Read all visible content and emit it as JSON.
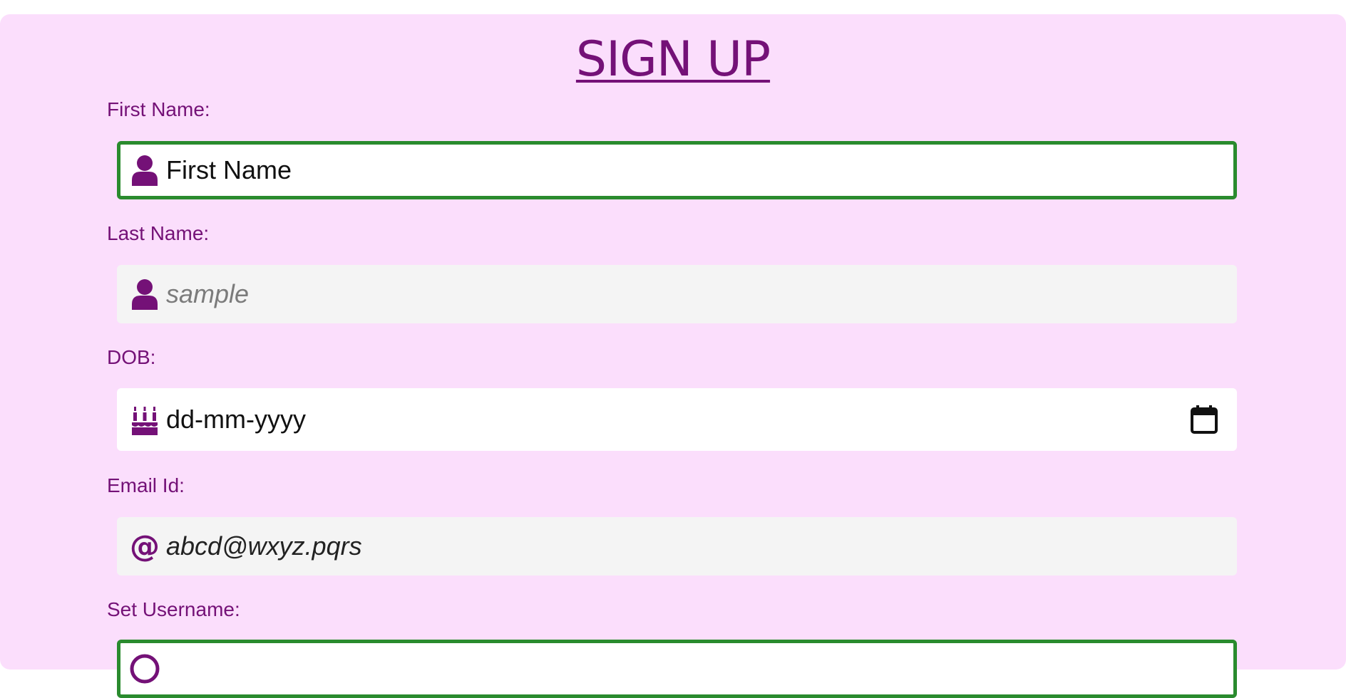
{
  "form": {
    "title": "SIGN UP",
    "accent_color": "#741177",
    "focus_border_color": "#2a8b2e",
    "background_color": "#fbdefc",
    "fields": [
      {
        "label": "First Name:",
        "icon": "user-icon",
        "value": "First Name",
        "placeholder": "",
        "state": "focused"
      },
      {
        "label": "Last Name:",
        "icon": "user-icon",
        "value": "",
        "placeholder": "sample",
        "state": "default"
      },
      {
        "label": "DOB:",
        "icon": "birthday-cake-icon",
        "value": "dd-mm-yyyy",
        "placeholder": "",
        "state": "default",
        "trailing_icon": "calendar-icon"
      },
      {
        "label": "Email Id:",
        "icon": "at-sign-icon",
        "value": "abcd@wxyz.pqrs",
        "placeholder": "",
        "state": "default"
      },
      {
        "label": "Set Username:",
        "icon": "username-icon",
        "value": "",
        "placeholder": "",
        "state": "focused"
      }
    ]
  }
}
